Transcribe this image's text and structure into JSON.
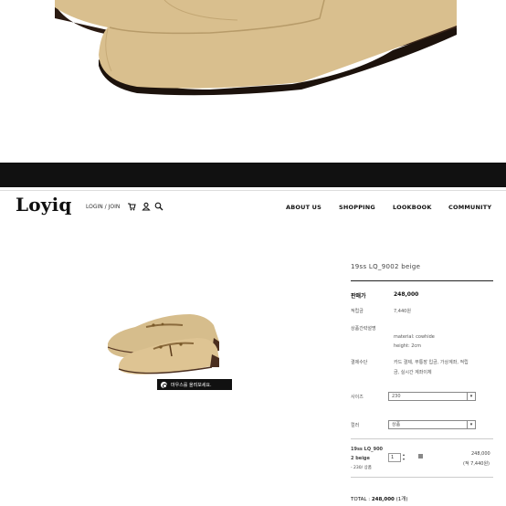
{
  "header": {
    "logo": "Loyiq",
    "login_join": "LOGIN / JOIN",
    "nav": [
      "ABOUT US",
      "SHOPPING",
      "LOOKBOOK",
      "COMMUNITY"
    ]
  },
  "product": {
    "title": "19ss LQ_9002 beige",
    "zoom_hint": "마우스를 올려보세요.",
    "price_label": "판매가",
    "price": "248,000",
    "points_label": "적립금",
    "points": "7,440원",
    "desc_label": "상품간략설명",
    "desc_line1": "material: cowhide",
    "desc_line2": "height: 2cm",
    "payment_label": "결제수단",
    "payment_line1": "카드 결제, 무통장 입금, 가상계좌, 적립",
    "payment_line2": "금, 실시간 계좌이체",
    "size_label": "사이즈",
    "size_value": "230",
    "color_label": "컬러",
    "color_value": "상품",
    "option_name_line1": "19ss LQ_900",
    "option_name_line2": "2 beige",
    "option_sub": "- 230/ 상품",
    "quantity": "1",
    "option_price": "248,000",
    "option_points": "(적 7,440원)",
    "total_label": "TOTAL :",
    "total_value": "248,000",
    "total_count": "(1개)"
  },
  "icons": [
    "cart-icon",
    "user-icon",
    "search-icon",
    "magnifier-icon",
    "chevron-down-icon",
    "remove-icon"
  ],
  "colors": {
    "band": "#111111",
    "shoe": "#d9bf8e",
    "sole": "#4a2e1f"
  }
}
